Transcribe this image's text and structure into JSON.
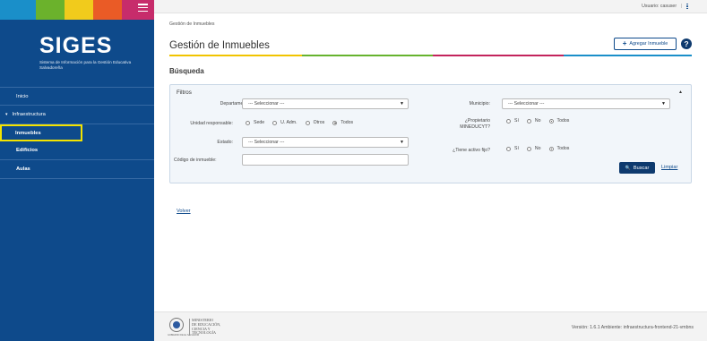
{
  "colors": {
    "sidebar": "#0e4a8b",
    "stripes": [
      "#1a8fc9",
      "#6bb22c",
      "#f1cb1c",
      "#ea5b26",
      "#c72c6b"
    ],
    "title_bar": [
      "#f1c400",
      "#66b32e",
      "#c3245c",
      "#1a8fc9"
    ],
    "active_outline": "#f3e300",
    "primary_button": "#0e3a6e"
  },
  "sidebar": {
    "logo_title": "SIGES",
    "logo_subtitle": "Sistema de Información para la Gestión Educativa Salvadoreña",
    "items": [
      {
        "label": "Inicio"
      },
      {
        "label": "Infraestructura",
        "caret": "▾"
      },
      {
        "label": "Inmuebles"
      },
      {
        "label": "Edificios"
      },
      {
        "label": "Aulas"
      }
    ]
  },
  "topbar": {
    "user_label": "Usuario: casuser",
    "separator": "|"
  },
  "main": {
    "breadcrumb": "Gestión de Inmuebles",
    "title": "Gestión de Inmuebles",
    "add_button_icon": "+",
    "add_button_label": "Agregar Inmueble",
    "help_icon": "?",
    "section_title": "Búsqueda",
    "filters": {
      "title": "Filtros",
      "collapse_icon": "▲",
      "departamento_label": "Departamento:",
      "departamento_value": "--- Seleccionar ---",
      "municipio_label": "Municipio:",
      "municipio_value": "--- Seleccionar ---",
      "unidad_label": "Unidad responsable:",
      "unidad_options": [
        "Sede",
        "U. Adm.",
        "Otros",
        "Todos"
      ],
      "unidad_selected": "Todos",
      "propietario_label": "¿Propietario MINEDUCYT?",
      "propietario_options": [
        "Sí",
        "No",
        "Todos"
      ],
      "propietario_selected": "Todos",
      "estado_label": "Estado:",
      "estado_value": "--- Seleccionar ---",
      "activo_label": "¿Tiene activo fijo?",
      "activo_options": [
        "Sí",
        "No",
        "Todos"
      ],
      "activo_selected": "Todos",
      "codigo_label": "Código de inmueble:",
      "codigo_value": "",
      "dropdown_arrow": "▼",
      "search_icon": "🔍",
      "search_label": "Buscar",
      "clear_label": "Limpiar"
    },
    "back_label": "Volver"
  },
  "footer": {
    "ministry": [
      "MINISTERIO",
      "DE EDUCACIÓN,",
      "CIENCIA Y",
      "TECNOLOGÍA"
    ],
    "seal_caption": "GOBIERNO DE EL SALVADOR",
    "version": "Versión: 1.6.1    Ambiente: infraestructura-frontend-21-vmbns"
  }
}
